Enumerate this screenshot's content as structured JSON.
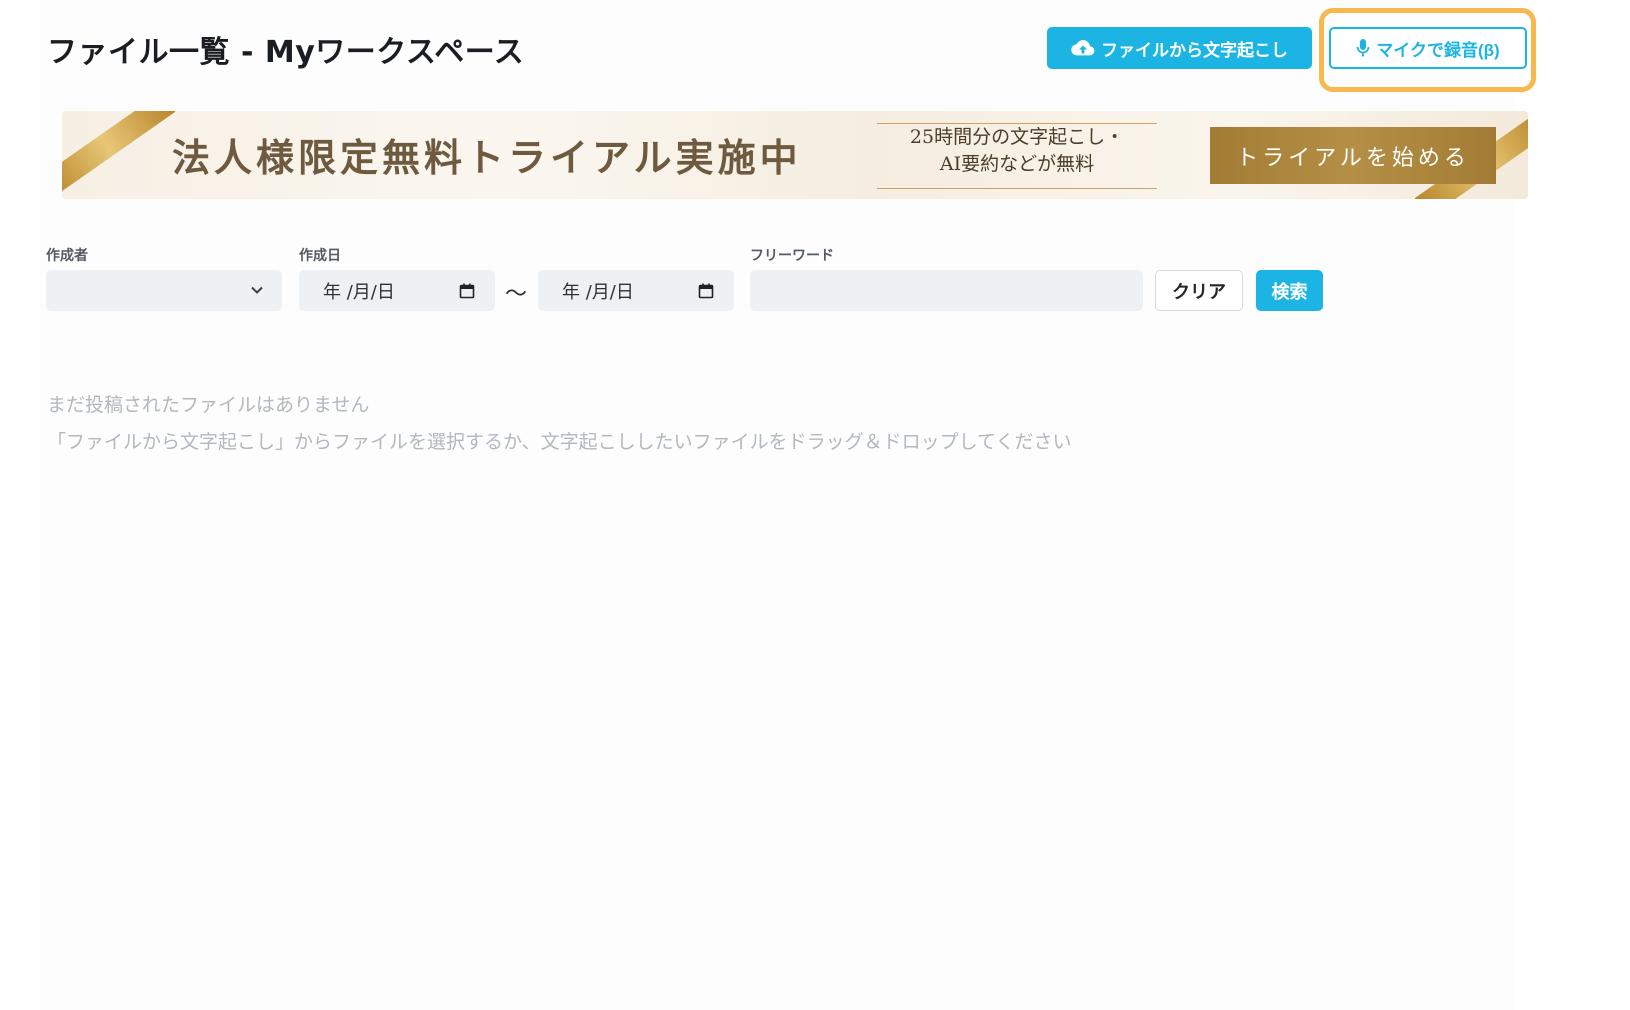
{
  "header": {
    "title": "ファイル一覧 - Myワークスペース",
    "upload_button": {
      "label": "ファイルから文字起こし",
      "icon": "cloud-upload-icon"
    },
    "mic_button": {
      "label": "マイクで録音(β)",
      "icon": "microphone-icon"
    }
  },
  "banner": {
    "headline": "法人様限定無料トライアル実施中",
    "sub_line1": "25時間分の文字起こし・",
    "sub_line2": "AI要約などが無料",
    "cta": "トライアルを始める"
  },
  "filters": {
    "author": {
      "label": "作成者",
      "value": ""
    },
    "date": {
      "label": "作成日",
      "from_placeholder": "年 /月/日",
      "separator": "〜",
      "to_placeholder": "年 /月/日"
    },
    "keyword": {
      "label": "フリーワード",
      "value": ""
    },
    "clear_label": "クリア",
    "search_label": "検索"
  },
  "empty_state": {
    "line1": "まだ投稿されたファイルはありません",
    "line2": "「ファイルから文字起こし」からファイルを選択するか、文字起こししたいファイルをドラッグ＆ドロップしてください"
  },
  "colors": {
    "accent": "#1cb5e3",
    "highlight": "#f6b84f",
    "banner_gold": "#a27c34"
  }
}
